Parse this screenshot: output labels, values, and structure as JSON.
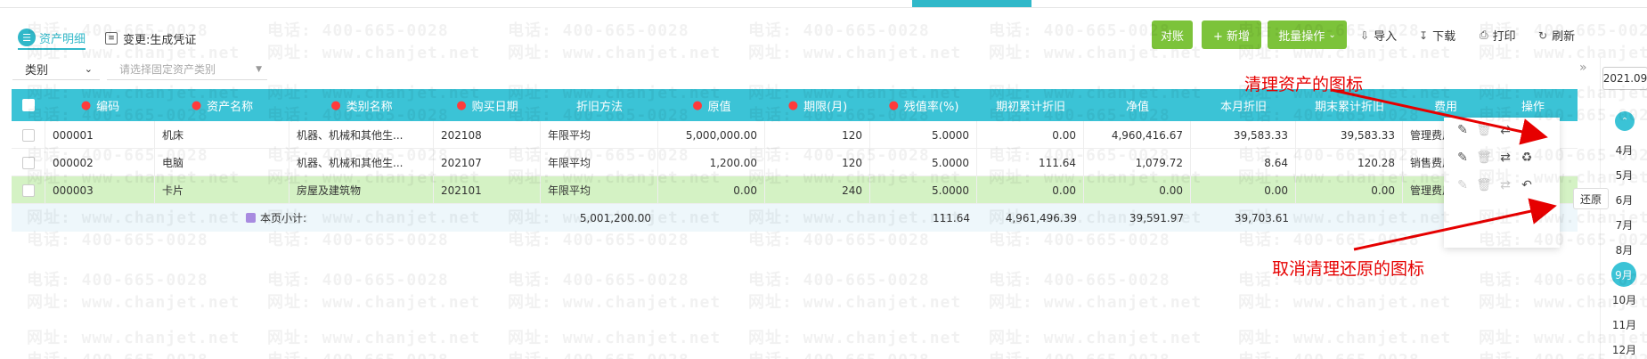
{
  "tabs": [
    {
      "label": "资产明细",
      "icon": "list-icon",
      "active": true
    },
    {
      "label": "变更:生成凭证",
      "icon": "document-icon",
      "active": false
    }
  ],
  "toolbar": {
    "reconcile": "对账",
    "add": "+ 新增",
    "batch": "批量操作",
    "import": "导入",
    "download": "下载",
    "print": "打印",
    "refresh": "刷新"
  },
  "filter": {
    "type_label": "类别",
    "category_placeholder": "请选择固定资产类别"
  },
  "columns": [
    {
      "label": "编码",
      "required": true
    },
    {
      "label": "资产名称",
      "required": true
    },
    {
      "label": "类别名称",
      "required": true
    },
    {
      "label": "购买日期",
      "required": true
    },
    {
      "label": "折旧方法",
      "required": false
    },
    {
      "label": "原值",
      "required": true
    },
    {
      "label": "期限(月)",
      "required": true
    },
    {
      "label": "残值率(%)",
      "required": true
    },
    {
      "label": "期初累计折旧",
      "required": false
    },
    {
      "label": "净值",
      "required": false
    },
    {
      "label": "本月折旧",
      "required": false
    },
    {
      "label": "期末累计折旧",
      "required": false
    },
    {
      "label": "费用",
      "required": false
    },
    {
      "label": "操作",
      "required": false
    }
  ],
  "rows": [
    [
      "000001",
      "机床",
      "机器、机械和其他生...",
      "202108",
      "年限平均",
      "5,000,000.00",
      "120",
      "5.0000",
      "0.00",
      "4,960,416.67",
      "39,583.33",
      "39,583.33",
      "管理费用_固定"
    ],
    [
      "000002",
      "电脑",
      "机器、机械和其他生...",
      "202107",
      "年限平均",
      "1,200.00",
      "120",
      "5.0000",
      "111.64",
      "1,079.72",
      "8.64",
      "120.28",
      "销售费用_商品"
    ],
    [
      "000003",
      "卡片",
      "房屋及建筑物",
      "202101",
      "年限平均",
      "0.00",
      "240",
      "5.0000",
      "0.00",
      "0.00",
      "0.00",
      "0.00",
      "管理费用_固定"
    ]
  ],
  "subtotal": {
    "label": "本页小计:",
    "original": "5,001,200.00",
    "opening": "111.64",
    "net": "4,961,496.39",
    "month": "39,591.97",
    "closing": "39,703.61"
  },
  "tooltip": "还原",
  "annotations": {
    "clean": "清理资产的图标",
    "restore": "取消清理还原的图标"
  },
  "right_panel": {
    "year": "2021.09",
    "months": [
      "4月",
      "5月",
      "6月",
      "7月",
      "8月",
      "9月",
      "10月",
      "11月",
      "12月"
    ],
    "current": "9月"
  },
  "watermark": {
    "phone": "电话: 400-665-0028",
    "site": "网址: www.chanjet.net"
  },
  "colors": {
    "header": "#3bc3d6",
    "accent": "#30b8c9",
    "green_button": "#7cc33a",
    "selected_row": "#d4f2c4",
    "annotation": "#e60000"
  }
}
